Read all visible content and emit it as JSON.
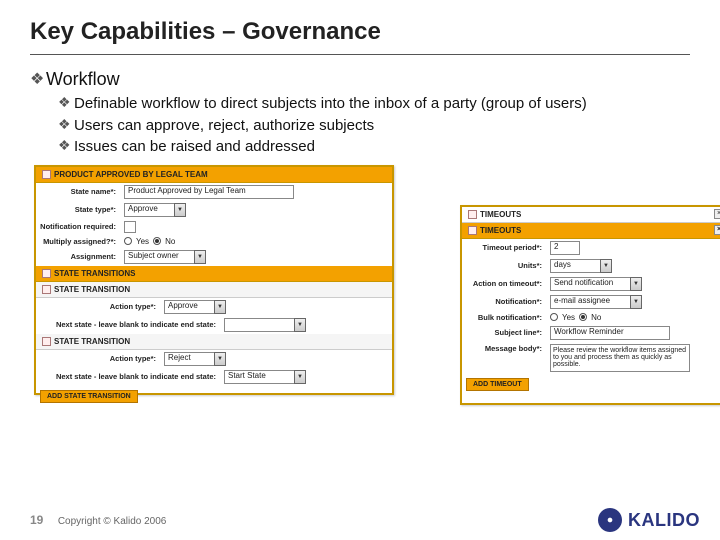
{
  "title": "Key Capabilities – Governance",
  "main_bullet": "Workflow",
  "sub_bullets": [
    "Definable workflow to direct subjects into the inbox of a party (group of users)",
    "Users can approve, reject, authorize subjects",
    "Issues can be raised and addressed"
  ],
  "panel_left": {
    "header": "PRODUCT APPROVED BY LEGAL TEAM",
    "fields": {
      "state_name_lbl": "State name*:",
      "state_name": "Product Approved by Legal Team",
      "state_type_lbl": "State type*:",
      "state_type": "Approve",
      "notif_req_lbl": "Notification required:",
      "mult_assign_lbl": "Multiply assigned?*:",
      "yes": "Yes",
      "no": "No",
      "assignment_lbl": "Assignment:",
      "assignment": "Subject owner"
    },
    "transitions_header": "STATE TRANSITIONS",
    "transition_header": "STATE TRANSITION",
    "t1": {
      "action_lbl": "Action type*:",
      "action": "Approve",
      "next_lbl": "Next state - leave blank to indicate end state:",
      "next": ""
    },
    "t2": {
      "action_lbl": "Action type*:",
      "action": "Reject",
      "next_lbl": "Next state - leave blank to indicate end state:",
      "next": "Start State"
    },
    "add_btn": "ADD STATE TRANSITION"
  },
  "panel_right": {
    "header": "TIMEOUTS",
    "sub": "TIMEOUTS",
    "fields": {
      "period_lbl": "Timeout period*:",
      "period": "2",
      "units_lbl": "Units*:",
      "units": "days",
      "action_lbl": "Action on timeout*:",
      "action": "Send notification",
      "notif_lbl": "Notification*:",
      "notif": "e-mail assignee",
      "bulk_lbl": "Bulk notification*:",
      "yes": "Yes",
      "no": "No",
      "subj_lbl": "Subject line*:",
      "subj": "Workflow Reminder",
      "body_lbl": "Message body*:",
      "body": "Please review the workflow items assigned to you and process them as quickly as possible."
    },
    "add_btn": "ADD TIMEOUT"
  },
  "footer": {
    "page": "19",
    "copyright": "Copyright © Kalido 2006",
    "brand": "KALIDO"
  }
}
